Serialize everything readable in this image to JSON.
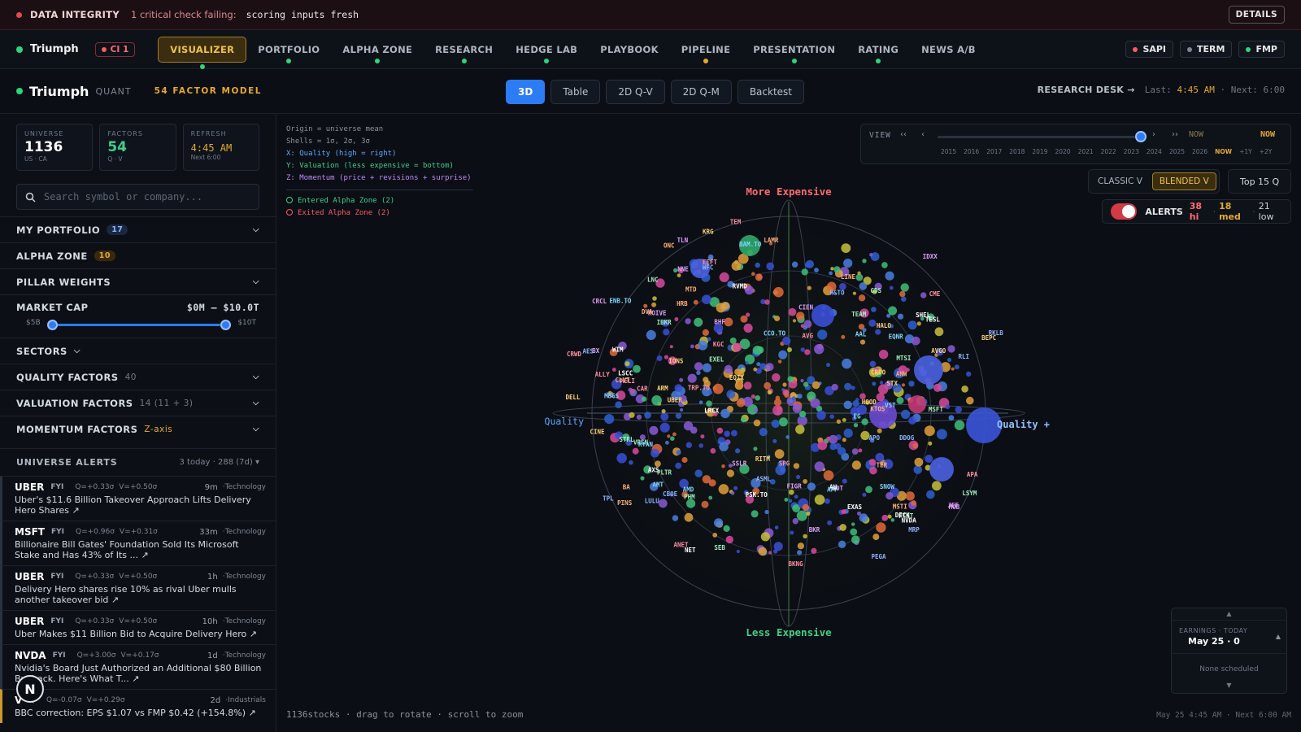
{
  "banner": {
    "title": "DATA INTEGRITY",
    "message": "1 critical check failing:",
    "check": "scoring inputs fresh",
    "details_label": "DETAILS"
  },
  "nav": {
    "brand": "Triumph",
    "ci_label": "CI 1",
    "tabs": [
      {
        "label": "VISUALIZER",
        "dot": "#2bd67b"
      },
      {
        "label": "PORTFOLIO",
        "dot": "#2bd67b"
      },
      {
        "label": "ALPHA ZONE",
        "dot": "#2bd67b"
      },
      {
        "label": "RESEARCH",
        "dot": "#2bd67b"
      },
      {
        "label": "HEDGE LAB",
        "dot": "#2bd67b"
      },
      {
        "label": "PLAYBOOK",
        "dot": ""
      },
      {
        "label": "PIPELINE",
        "dot": "#e6a82e"
      },
      {
        "label": "PRESENTATION",
        "dot": "#2bd67b"
      },
      {
        "label": "RATING",
        "dot": "#2bd67b"
      },
      {
        "label": "NEWS A/B",
        "dot": ""
      }
    ],
    "right": [
      {
        "label": "SAPI",
        "color": "#ff5a63"
      },
      {
        "label": "TERM",
        "color": "#7d8694"
      },
      {
        "label": "FMP",
        "color": "#2bd67b"
      }
    ]
  },
  "sub": {
    "name": "Triumph",
    "quant": "QUANT",
    "factor": "54 FACTOR MODEL",
    "views": [
      "3D",
      "Table",
      "2D Q-V",
      "2D Q-M",
      "Backtest"
    ],
    "research": "RESEARCH DESK →",
    "last_label": "Last:",
    "last": "4:45 AM",
    "next_label": "Next:",
    "next": "6:00"
  },
  "side": {
    "stats": [
      {
        "label": "UNIVERSE",
        "value": "1136",
        "sub": "US · CA",
        "color": "#ffffff"
      },
      {
        "label": "FACTORS",
        "value": "54",
        "sub": "Q · V",
        "color": "#3fd18a"
      },
      {
        "label": "REFRESH",
        "value": "4:45 AM",
        "sub": "Next 6:00",
        "color": "#e6a82e"
      }
    ],
    "search_placeholder": "Search symbol or company...",
    "portfolio": {
      "label": "MY PORTFOLIO",
      "count": "17"
    },
    "alpha": {
      "label": "ALPHA ZONE",
      "count": "10"
    },
    "pillar": "PILLAR WEIGHTS",
    "mcap": {
      "label": "MARKET CAP",
      "range": "$0M – $10.0T",
      "lo": "$5B",
      "hi": "$10T"
    },
    "sectors": "SECTORS",
    "quality": {
      "label": "QUALITY FACTORS",
      "count": "40"
    },
    "valuation": {
      "label": "VALUATION FACTORS",
      "count": "14 (11 + 3)"
    },
    "momentum": {
      "label": "MOMENTUM FACTORS",
      "count": "Z-axis"
    },
    "alerts": {
      "label": "UNIVERSE ALERTS",
      "count": "3 today · 288 (7d)"
    },
    "news": [
      {
        "sym": "UBER",
        "tag": "FYI",
        "q": "Q=+0.33σ",
        "v": "V=+0.50σ",
        "time": "9m",
        "sector": "Technology",
        "headline": "Uber's $11.6 Billion Takeover Approach Lifts Delivery Hero Shares ↗"
      },
      {
        "sym": "MSFT",
        "tag": "FYI",
        "q": "Q=+0.96σ",
        "v": "V=+0.31σ",
        "time": "33m",
        "sector": "Technology",
        "headline": "Billionaire Bill Gates' Foundation Sold Its Microsoft Stake and Has 43% of Its ... ↗"
      },
      {
        "sym": "UBER",
        "tag": "FYI",
        "q": "Q=+0.33σ",
        "v": "V=+0.50σ",
        "time": "1h",
        "sector": "Technology",
        "headline": "Delivery Hero shares rise 10% as rival Uber mulls another takeover bid ↗"
      },
      {
        "sym": "UBER",
        "tag": "FYI",
        "q": "Q=+0.33σ",
        "v": "V=+0.50σ",
        "time": "10h",
        "sector": "Technology",
        "headline": "Uber Makes $11 Billion Bid to Acquire Delivery Hero ↗"
      },
      {
        "sym": "NVDA",
        "tag": "FYI",
        "q": "Q=+3.00σ",
        "v": "V=+0.17σ",
        "time": "1d",
        "sector": "Technology",
        "headline": "Nvidia's Board Just Authorized an Additional $80 Billion Buyback. Here's What T... ↗"
      },
      {
        "sym": "V",
        "tag": "Q",
        "q": "Q=-0.07σ",
        "v": "V=+0.29σ",
        "time": "2d",
        "sector": "Industrials",
        "headline": "BBC correction: EPS $1.07 vs FMP $0.42 (+154.8%) ↗"
      }
    ]
  },
  "main": {
    "legend": [
      "Origin = universe mean",
      "Shells = 1σ, 2σ, 3σ",
      "X: Quality (high = right)",
      "Y: Valuation (less expensive = bottom)",
      "Z: Momentum (price + revisions + surprise)"
    ],
    "entered": "Entered Alpha Zone (2)",
    "exited": "Exited Alpha Zone (2)",
    "timeline": {
      "label": "VIEW",
      "now1": "NOW",
      "now2": "NOW",
      "years": [
        "2015",
        "2016",
        "2017",
        "2018",
        "2019",
        "2020",
        "2021",
        "2022",
        "2023",
        "2024",
        "2025",
        "2026",
        "NOW",
        "+1Y",
        "+2Y"
      ]
    },
    "classic": "CLASSIC V",
    "blended": "BLENDED V",
    "top15": "Top 15 Q",
    "alerts": {
      "label": "ALERTS",
      "hi": "38 hi",
      "med": "18 med",
      "low": "21 low"
    },
    "axes": {
      "top": "More Expensive",
      "bottom": "Less Expensive",
      "left": "Quality",
      "right": "Quality +"
    },
    "tickers": [
      "CRWD",
      "DDOG",
      "ARM",
      "PLTR",
      "CIEN",
      "NET",
      "SNOW",
      "MSTI",
      "BKNG",
      "APO",
      "DELL",
      "IBKR",
      "CRCL",
      "EXAS",
      "CCO.TO",
      "ANW",
      "MELI",
      "RKLB",
      "IONS",
      "GDS",
      "ROIVE",
      "RVMD",
      "MSGS",
      "KTOS",
      "TEM",
      "H&TO",
      "EQIX",
      "MTSI",
      "MOB",
      "LSCC",
      "BAM.TO",
      "LAMR",
      "SPG",
      "CBOE",
      "HOOD",
      "LSYM",
      "FIGR",
      "PSK.TO",
      "AMD",
      "ONC",
      "CME",
      "TPL",
      "CRDO",
      "FTNT",
      "BX",
      "LRCX",
      "AMT",
      "TER",
      "TRP.TO",
      "RLI",
      "CINE",
      "STRL",
      "JOT",
      "TESL",
      "ENB.TO",
      "BA",
      "AVG",
      "ASML",
      "AVGO",
      "VRSN",
      "IDXX",
      "NVDA",
      "APP",
      "MTD",
      "ANET",
      "LULU",
      "STX",
      "TEAM",
      "SSLR",
      "AU",
      "VST",
      "PINS",
      "KGC",
      "PEGA",
      "HALO",
      "EXEL",
      "TLN",
      "DECK",
      "RYAN",
      "LINE",
      "CAR",
      "VG",
      "BEPC",
      "SEB",
      "JEF",
      "AXS",
      "AAL",
      "DVA",
      "ALLY",
      "AES",
      "RITM",
      "LNC",
      "BHF",
      "WIM",
      "EG",
      "CLVT",
      "EEFT",
      "MRP",
      "UBER",
      "MSFT",
      "BKR",
      "SHEL",
      "EQNR",
      "HRB",
      "APA",
      "WFC",
      "KRG",
      "PHM",
      "NNE"
    ],
    "footer": "1136stocks · drag to rotate · scroll to zoom",
    "footer_right": "May 25 4:45 AM · Next 6:00 AM",
    "earnings": {
      "label": "EARNINGS · TODAY",
      "date": "May 25 · 0",
      "none": "None scheduled"
    }
  }
}
